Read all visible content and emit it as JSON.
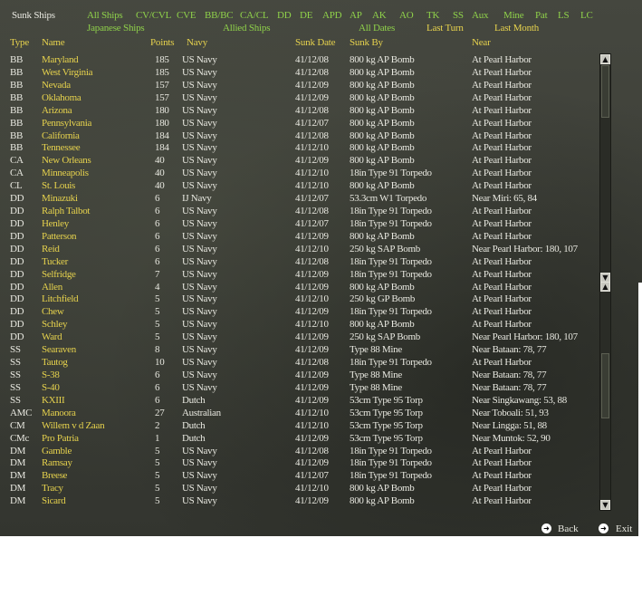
{
  "screen_title": "Sunk Ships",
  "filters_row1": [
    "All Ships",
    "CV/CVL",
    "CVE",
    "BB/BC",
    "CA/CL",
    "DD",
    "DE",
    "APD",
    "AP",
    "AK",
    "AO",
    "TK",
    "SS",
    "Aux",
    "Mine",
    "Pat",
    "LS",
    "LC"
  ],
  "filters_row2": {
    "japanese": "Japanese Ships",
    "allied": "Allied Ships",
    "all_dates": "All Dates",
    "last_turn": "Last Turn",
    "last_month": "Last Month"
  },
  "columns": {
    "type": "Type",
    "name": "Name",
    "points": "Points",
    "navy": "Navy",
    "sunk_date": "Sunk Date",
    "sunk_by": "Sunk By",
    "near": "Near"
  },
  "rows": [
    {
      "type": "BB",
      "name": "Maryland",
      "points": "185",
      "navy": "US Navy",
      "date": "41/12/08",
      "by": "800 kg AP Bomb",
      "near": "At Pearl Harbor"
    },
    {
      "type": "BB",
      "name": "West Virginia",
      "points": "185",
      "navy": "US Navy",
      "date": "41/12/08",
      "by": "800 kg AP Bomb",
      "near": "At Pearl Harbor"
    },
    {
      "type": "BB",
      "name": "Nevada",
      "points": "157",
      "navy": "US Navy",
      "date": "41/12/09",
      "by": "800 kg AP Bomb",
      "near": "At Pearl Harbor"
    },
    {
      "type": "BB",
      "name": "Oklahoma",
      "points": "157",
      "navy": "US Navy",
      "date": "41/12/09",
      "by": "800 kg AP Bomb",
      "near": "At Pearl Harbor"
    },
    {
      "type": "BB",
      "name": "Arizona",
      "points": "180",
      "navy": "US Navy",
      "date": "41/12/08",
      "by": "800 kg AP Bomb",
      "near": "At Pearl Harbor"
    },
    {
      "type": "BB",
      "name": "Pennsylvania",
      "points": "180",
      "navy": "US Navy",
      "date": "41/12/07",
      "by": "800 kg AP Bomb",
      "near": "At Pearl Harbor"
    },
    {
      "type": "BB",
      "name": "California",
      "points": "184",
      "navy": "US Navy",
      "date": "41/12/08",
      "by": "800 kg AP Bomb",
      "near": "At Pearl Harbor"
    },
    {
      "type": "BB",
      "name": "Tennessee",
      "points": "184",
      "navy": "US Navy",
      "date": "41/12/10",
      "by": "800 kg AP Bomb",
      "near": "At Pearl Harbor"
    },
    {
      "type": "CA",
      "name": "New Orleans",
      "points": "40",
      "navy": "US Navy",
      "date": "41/12/09",
      "by": "800 kg AP Bomb",
      "near": "At Pearl Harbor"
    },
    {
      "type": "CA",
      "name": "Minneapolis",
      "points": "40",
      "navy": "US Navy",
      "date": "41/12/10",
      "by": "18in Type 91 Torpedo",
      "near": "At Pearl Harbor"
    },
    {
      "type": "CL",
      "name": "St. Louis",
      "points": "40",
      "navy": "US Navy",
      "date": "41/12/10",
      "by": "800 kg AP Bomb",
      "near": "At Pearl Harbor"
    },
    {
      "type": "DD",
      "name": "Minazuki",
      "points": "6",
      "navy": "IJ Navy",
      "date": "41/12/07",
      "by": "53.3cm W1 Torpedo",
      "near": "Near Miri: 65, 84"
    },
    {
      "type": "DD",
      "name": "Ralph Talbot",
      "points": "6",
      "navy": "US Navy",
      "date": "41/12/08",
      "by": "18in Type 91 Torpedo",
      "near": "At Pearl Harbor"
    },
    {
      "type": "DD",
      "name": "Henley",
      "points": "6",
      "navy": "US Navy",
      "date": "41/12/07",
      "by": "18in Type 91 Torpedo",
      "near": "At Pearl Harbor"
    },
    {
      "type": "DD",
      "name": "Patterson",
      "points": "6",
      "navy": "US Navy",
      "date": "41/12/09",
      "by": "800 kg AP Bomb",
      "near": "At Pearl Harbor"
    },
    {
      "type": "DD",
      "name": "Reid",
      "points": "6",
      "navy": "US Navy",
      "date": "41/12/10",
      "by": "250 kg SAP Bomb",
      "near": "Near Pearl Harbor: 180, 107"
    },
    {
      "type": "DD",
      "name": "Tucker",
      "points": "6",
      "navy": "US Navy",
      "date": "41/12/08",
      "by": "18in Type 91 Torpedo",
      "near": "At Pearl Harbor"
    },
    {
      "type": "DD",
      "name": "Selfridge",
      "points": "7",
      "navy": "US Navy",
      "date": "41/12/09",
      "by": "18in Type 91 Torpedo",
      "near": "At Pearl Harbor"
    },
    {
      "type": "DD",
      "name": "Allen",
      "points": "4",
      "navy": "US Navy",
      "date": "41/12/09",
      "by": "800 kg AP Bomb",
      "near": "At Pearl Harbor"
    },
    {
      "type": "DD",
      "name": "Litchfield",
      "points": "5",
      "navy": "US Navy",
      "date": "41/12/10",
      "by": "250 kg GP Bomb",
      "near": "At Pearl Harbor"
    },
    {
      "type": "DD",
      "name": "Chew",
      "points": "5",
      "navy": "US Navy",
      "date": "41/12/09",
      "by": "18in Type 91 Torpedo",
      "near": "At Pearl Harbor"
    },
    {
      "type": "DD",
      "name": "Schley",
      "points": "5",
      "navy": "US Navy",
      "date": "41/12/10",
      "by": "800 kg AP Bomb",
      "near": "At Pearl Harbor"
    },
    {
      "type": "DD",
      "name": "Ward",
      "points": "5",
      "navy": "US Navy",
      "date": "41/12/09",
      "by": "250 kg SAP Bomb",
      "near": "Near Pearl Harbor: 180, 107"
    },
    {
      "type": "SS",
      "name": "Searaven",
      "points": "8",
      "navy": "US Navy",
      "date": "41/12/09",
      "by": "Type 88 Mine",
      "near": "Near Bataan: 78, 77"
    },
    {
      "type": "SS",
      "name": "Tautog",
      "points": "10",
      "navy": "US Navy",
      "date": "41/12/08",
      "by": "18in Type 91 Torpedo",
      "near": "At Pearl Harbor"
    },
    {
      "type": "SS",
      "name": "S-38",
      "points": "6",
      "navy": "US Navy",
      "date": "41/12/09",
      "by": "Type 88 Mine",
      "near": "Near Bataan: 78, 77"
    },
    {
      "type": "SS",
      "name": "S-40",
      "points": "6",
      "navy": "US Navy",
      "date": "41/12/09",
      "by": "Type 88 Mine",
      "near": "Near Bataan: 78, 77"
    },
    {
      "type": "SS",
      "name": "KXIII",
      "points": "6",
      "navy": "Dutch",
      "date": "41/12/09",
      "by": "53cm Type 95 Torp",
      "near": "Near Singkawang: 53, 88"
    },
    {
      "type": "AMC",
      "name": "Manoora",
      "points": "27",
      "navy": "Australian",
      "date": "41/12/10",
      "by": "53cm Type 95 Torp",
      "near": "Near Toboali: 51, 93"
    },
    {
      "type": "CM",
      "name": "Willem v d Zaan",
      "points": "2",
      "navy": "Dutch",
      "date": "41/12/10",
      "by": "53cm Type 95 Torp",
      "near": "Near Lingga: 51, 88"
    },
    {
      "type": "CMc",
      "name": "Pro Patria",
      "points": "1",
      "navy": "Dutch",
      "date": "41/12/09",
      "by": "53cm Type 95 Torp",
      "near": "Near Muntok: 52, 90"
    },
    {
      "type": "DM",
      "name": "Gamble",
      "points": "5",
      "navy": "US Navy",
      "date": "41/12/08",
      "by": "18in Type 91 Torpedo",
      "near": "At Pearl Harbor"
    },
    {
      "type": "DM",
      "name": "Ramsay",
      "points": "5",
      "navy": "US Navy",
      "date": "41/12/09",
      "by": "18in Type 91 Torpedo",
      "near": "At Pearl Harbor"
    },
    {
      "type": "DM",
      "name": "Breese",
      "points": "5",
      "navy": "US Navy",
      "date": "41/12/07",
      "by": "18in Type 91 Torpedo",
      "near": "At Pearl Harbor"
    },
    {
      "type": "DM",
      "name": "Tracy",
      "points": "5",
      "navy": "US Navy",
      "date": "41/12/10",
      "by": "800 kg AP Bomb",
      "near": "At Pearl Harbor"
    },
    {
      "type": "DM",
      "name": "Sicard",
      "points": "5",
      "navy": "US Navy",
      "date": "41/12/09",
      "by": "800 kg AP Bomb",
      "near": "At Pearl Harbor"
    }
  ],
  "footer": {
    "back": "Back",
    "exit": "Exit"
  },
  "icons": {
    "scroll_up": "arrow-up-icon",
    "scroll_down": "arrow-down-icon",
    "back": "back-arrow-icon",
    "exit": "exit-arrow-icon"
  },
  "colors": {
    "filter_green": "#8fd14a",
    "header_yellow": "#e6d24d",
    "text_white": "#e8e8e0",
    "background": "#3e4039"
  }
}
